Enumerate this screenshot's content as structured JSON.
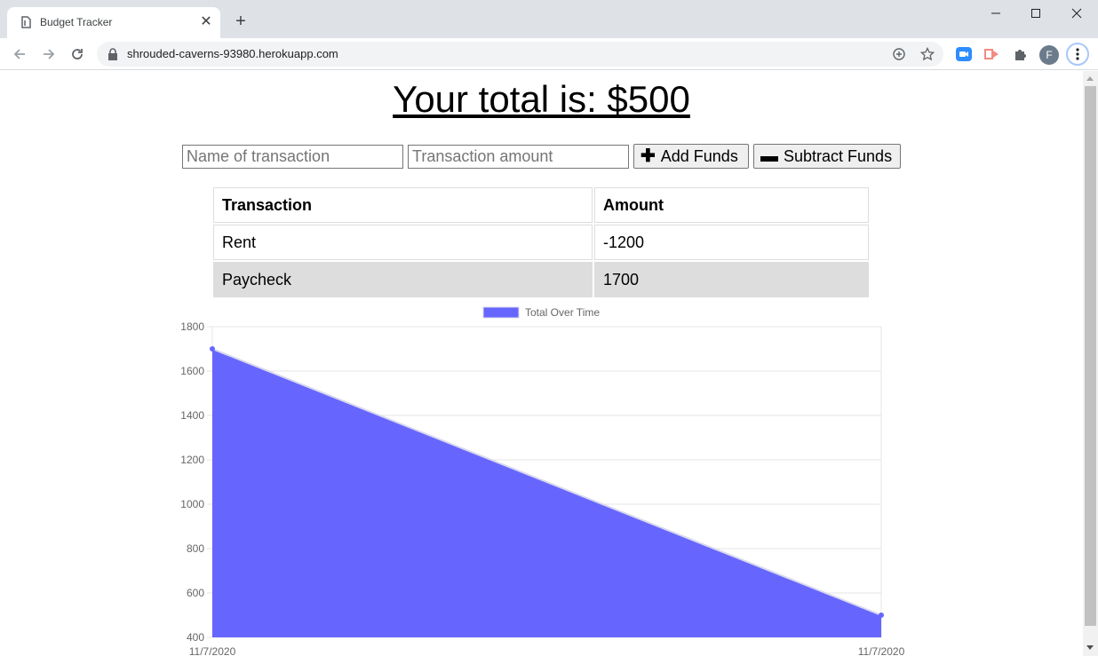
{
  "browser": {
    "tab_title": "Budget Tracker",
    "url": "shrouded-caverns-93980.herokuapp.com",
    "profile_initial": "F"
  },
  "page": {
    "total_text": "Your total is: $500",
    "name_placeholder": "Name of transaction",
    "amount_placeholder": "Transaction amount",
    "add_label": "Add Funds",
    "subtract_label": "Subtract Funds",
    "table": {
      "headers": [
        "Transaction",
        "Amount"
      ],
      "rows": [
        {
          "name": "Rent",
          "amount": "-1200"
        },
        {
          "name": "Paycheck",
          "amount": "1700"
        }
      ]
    }
  },
  "chart_data": {
    "type": "area",
    "x": [
      "11/7/2020",
      "11/7/2020"
    ],
    "series": [
      {
        "name": "Total Over Time",
        "values": [
          1700,
          500
        ],
        "color": "#6666ff"
      }
    ],
    "ylim": [
      400,
      1800
    ],
    "yticks": [
      400,
      600,
      800,
      1000,
      1200,
      1400,
      1600,
      1800
    ],
    "legend": "top-center",
    "grid": true
  }
}
